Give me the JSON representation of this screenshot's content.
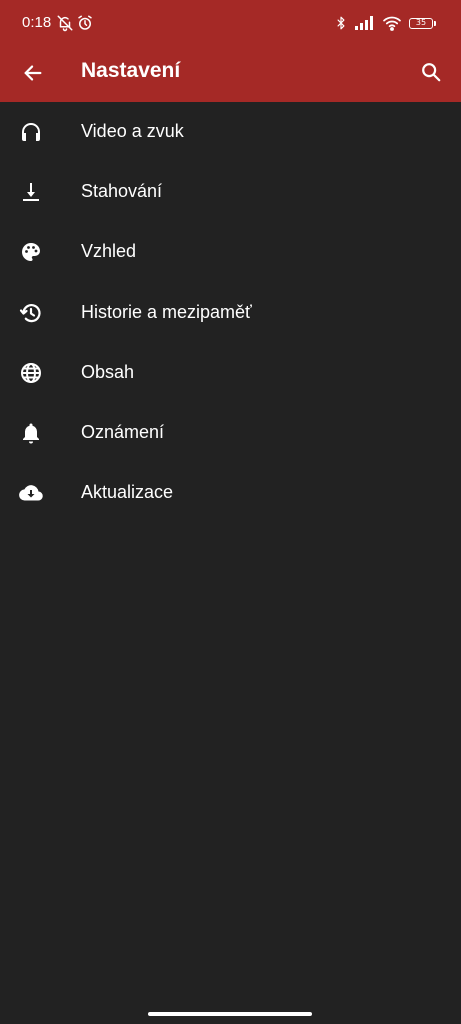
{
  "colors": {
    "toolbar_bg": "#a52926",
    "page_bg": "#222222",
    "text": "#ffffff"
  },
  "status_bar": {
    "time": "0:18",
    "battery": "35",
    "left_icons": [
      "bell-off-icon",
      "alarm-icon"
    ],
    "right_icons": [
      "bluetooth-icon",
      "signal-icon",
      "wifi-icon",
      "battery-icon"
    ]
  },
  "toolbar": {
    "title": "Nastavení",
    "back_icon": "arrow-left-icon",
    "search_icon": "search-icon"
  },
  "menu": {
    "items": [
      {
        "label": "Video a zvuk",
        "icon": "headphones-icon"
      },
      {
        "label": "Stahování",
        "icon": "download-icon"
      },
      {
        "label": "Vzhled",
        "icon": "palette-icon"
      },
      {
        "label": "Historie a mezipaměť",
        "icon": "history-icon"
      },
      {
        "label": "Obsah",
        "icon": "globe-icon"
      },
      {
        "label": "Oznámení",
        "icon": "bell-icon"
      },
      {
        "label": "Aktualizace",
        "icon": "cloud-download-icon"
      }
    ]
  }
}
